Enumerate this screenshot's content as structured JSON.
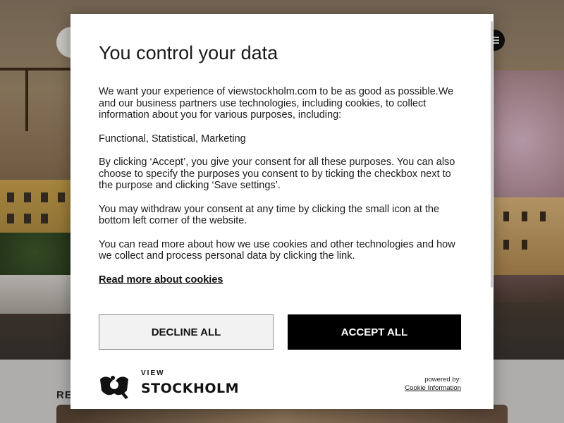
{
  "modal": {
    "title": "You control your data",
    "paragraphs": [
      "We want your experience of viewstockholm.com to be as good as possible.We and our business partners use technologies, including cookies, to collect information about you for various purposes, including:",
      "Functional, Statistical, Marketing",
      "By clicking ‘Accept’, you give your consent for all these purposes. You can also choose to specify the purposes you consent to by ticking the checkbox next to the purpose and clicking ‘Save settings’.",
      "You may withdraw your consent at any time by clicking the small icon at the bottom left corner of the website.",
      "You can read more about how we use cookies and other technologies and how we collect and process personal data by clicking the link."
    ],
    "read_more_label": "Read more about cookies",
    "decline_label": "DECLINE ALL",
    "accept_label": "ACCEPT ALL",
    "logo": {
      "top_text": "VIEW",
      "main_text": "STOCKHOLM",
      "icon": "view-stockholm-logo-icon"
    },
    "powered_by": "powered by:",
    "powered_by_link": "Cookie Information"
  },
  "background": {
    "section_heading": "RE",
    "menu_icon": "hamburger-menu-icon"
  },
  "colors": {
    "accept_bg": "#000000",
    "decline_bg": "#f2f2f2",
    "modal_bg": "#ffffff"
  }
}
